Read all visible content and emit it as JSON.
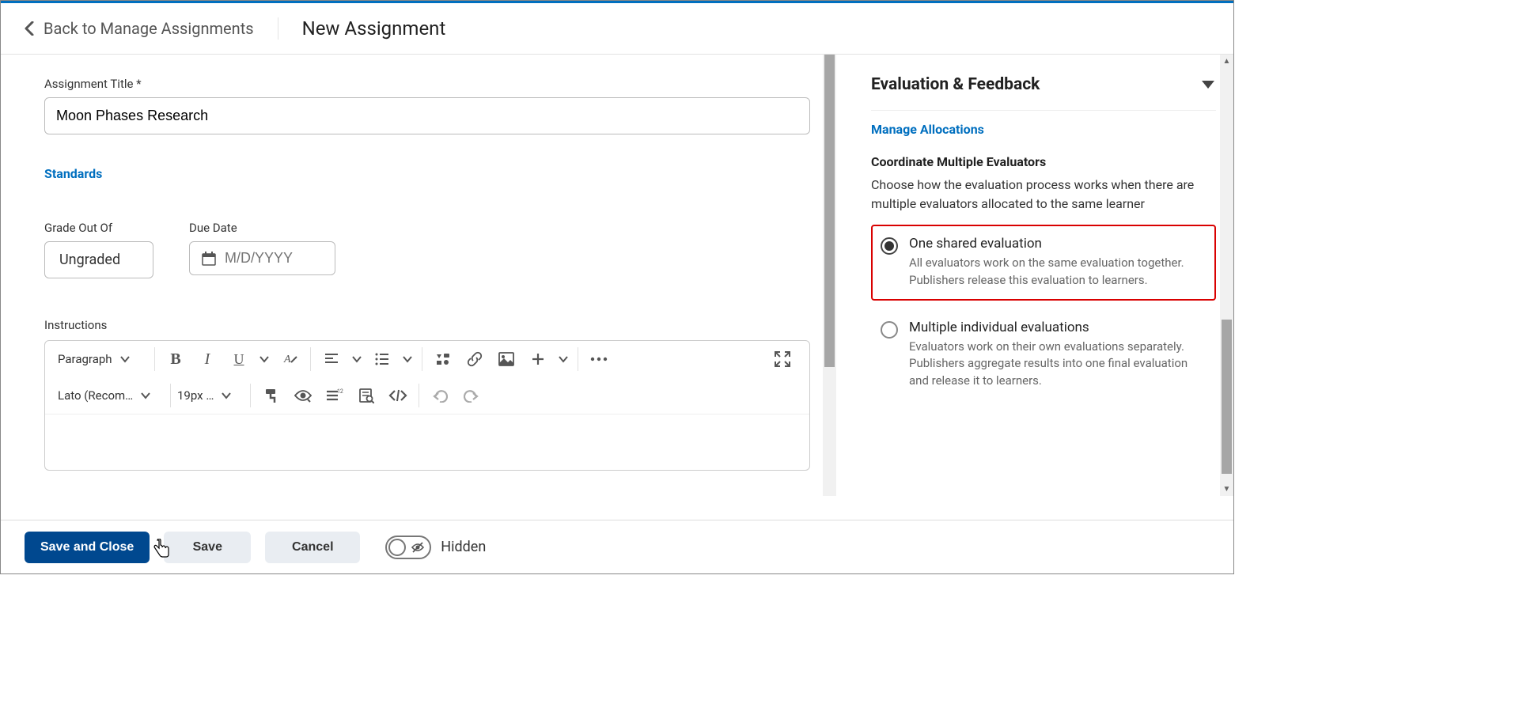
{
  "header": {
    "back_label": "Back to Manage Assignments",
    "page_title": "New Assignment"
  },
  "main": {
    "title_label": "Assignment Title *",
    "title_value": "Moon Phases Research",
    "standards_link": "Standards",
    "grade_label": "Grade Out Of",
    "grade_value": "Ungraded",
    "due_label": "Due Date",
    "due_placeholder": "M/D/YYYY",
    "instructions_label": "Instructions",
    "toolbar": {
      "block_format": "Paragraph",
      "font_family": "Lato (Recom…",
      "font_size": "19px …"
    }
  },
  "side": {
    "panel_title": "Evaluation & Feedback",
    "manage_link": "Manage Allocations",
    "coord_heading": "Coordinate Multiple Evaluators",
    "coord_desc": "Choose how the evaluation process works when there are multiple evaluators allocated to the same learner",
    "opt1_label": "One shared evaluation",
    "opt1_desc": "All evaluators work on the same evaluation together. Publishers release this evaluation to learners.",
    "opt2_label": "Multiple individual evaluations",
    "opt2_desc": "Evaluators work on their own evaluations separately. Publishers aggregate results into one final evaluation and release it to learners."
  },
  "footer": {
    "save_close": "Save and Close",
    "save": "Save",
    "cancel": "Cancel",
    "hidden_label": "Hidden"
  }
}
